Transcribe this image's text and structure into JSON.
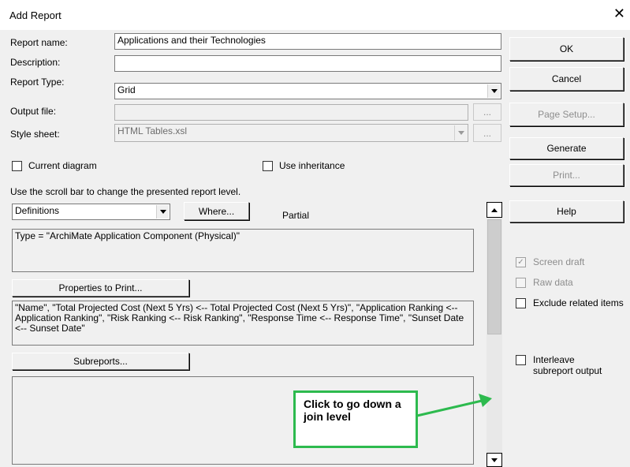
{
  "window": {
    "title": "Add Report",
    "close_glyph": "✕"
  },
  "labels": {
    "report_name": "Report name:",
    "description": "Description:",
    "report_type": "Report Type:",
    "output_file": "Output file:",
    "style_sheet": "Style sheet:",
    "instructions": "Use the scroll bar to change the presented report level.",
    "partial": "Partial"
  },
  "fields": {
    "report_name": "Applications and their Technologies",
    "description": "",
    "report_type": "Grid",
    "output_file": "",
    "style_sheet": "HTML Tables.xsl",
    "level": "Definitions"
  },
  "browse_label": "...",
  "checkboxes": {
    "current_diagram": {
      "label": "Current diagram",
      "checked": false
    },
    "use_inheritance": {
      "label": "Use inheritance",
      "checked": false
    },
    "screen_draft": {
      "label": "Screen draft",
      "checked": true,
      "enabled": false
    },
    "raw_data": {
      "label": "Raw data",
      "checked": false,
      "enabled": false
    },
    "exclude_related": {
      "label": "Exclude related items",
      "checked": false,
      "enabled": true
    },
    "interleave": {
      "label": "Interleave subreport output",
      "checked": false,
      "enabled": true
    }
  },
  "buttons": {
    "where": "Where...",
    "properties": "Properties to Print...",
    "subreports": "Subreports...",
    "ok": "OK",
    "cancel": "Cancel",
    "page_setup": "Page Setup...",
    "generate": "Generate",
    "print": "Print...",
    "help": "Help"
  },
  "boxes": {
    "where_clause": "Type = \"ArchiMate Application Component (Physical)\"",
    "properties_list": "\"Name\", \"Total Projected Cost (Next 5 Yrs) <-- Total Projected Cost (Next 5 Yrs)\", \"Application Ranking <-- Application Ranking\", \"Risk Ranking <-- Risk Ranking\", \"Response Time <-- Response Time\", \"Sunset Date <-- Sunset Date\"",
    "subreports_list": ""
  },
  "annotation": {
    "text": "Click to go down a join level",
    "color": "#2dba4e"
  }
}
